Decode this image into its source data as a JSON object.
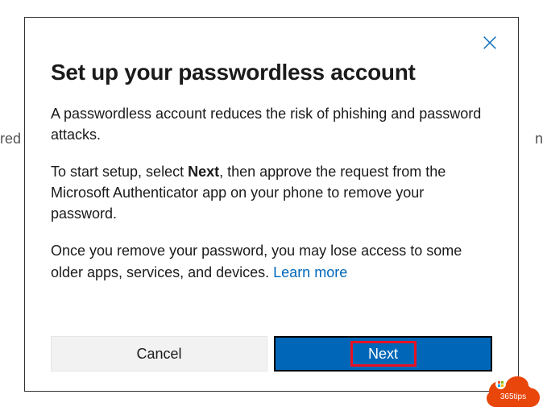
{
  "dialog": {
    "title": "Set up your passwordless account",
    "para1": "A passwordless account reduces the risk of phishing and password attacks.",
    "para2_prefix": "To start setup, select ",
    "para2_bold": "Next",
    "para2_suffix": ", then approve the request from the Microsoft Authenticator app on your phone to remove your password.",
    "para3_text": "Once you remove your password, you may lose access to some older apps, services, and devices. ",
    "learn_more": "Learn more",
    "cancel_label": "Cancel",
    "next_label": "Next"
  },
  "badge": {
    "label": "365tips"
  },
  "bg": {
    "left": "red",
    "right": "n"
  }
}
